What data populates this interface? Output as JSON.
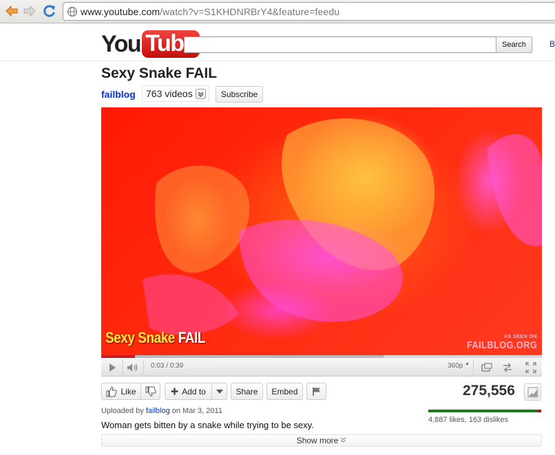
{
  "browser": {
    "url_host": "www.youtube.com",
    "url_path": "/watch?v=S1KHDNRBrY4&feature=feedu",
    "icons": [
      "back-arrow-icon",
      "forward-arrow-icon",
      "reload-icon",
      "globe-icon"
    ]
  },
  "header": {
    "logo_you": "You",
    "logo_tube": "Tube",
    "search_placeholder": "",
    "search_label": "Search",
    "cut_link": "B"
  },
  "video": {
    "title": "Sexy Snake FAIL",
    "channel": "failblog",
    "video_count": "763 videos",
    "subscribe_label": "Subscribe",
    "caption_part1": "Sexy Snake ",
    "caption_part2": "FAIL",
    "watermark_small": "AS SEEN ON",
    "watermark_brand": "FAILBLOG.ORG"
  },
  "player": {
    "time": "0:03 / 0:39",
    "quality": "360p",
    "played_fraction": 0.077,
    "loaded_fraction": 0.64
  },
  "actions": {
    "like_label": "Like",
    "add_to_label": "Add to",
    "share_label": "Share",
    "embed_label": "Embed"
  },
  "stats": {
    "views": "275,556",
    "likes": 4887,
    "dislikes": 163,
    "ratings_text": "4,887 likes, 163 dislikes"
  },
  "details": {
    "uploaded_prefix": "Uploaded by",
    "uploader": "failblog",
    "uploaded_suffix": "on Mar 3, 2011",
    "description": "Woman gets bitten by a snake while trying to be sexy.",
    "show_more_label": "Show more"
  },
  "colors": {
    "link": "#0033cc",
    "logo_red": "#e62117",
    "likes_green": "#1c7a1c",
    "dislikes_red": "#cc0000",
    "video_tint": "#ff2a0e"
  }
}
